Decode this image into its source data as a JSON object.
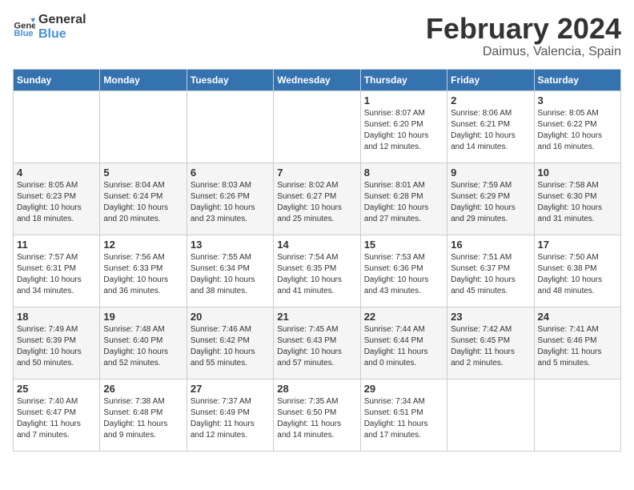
{
  "header": {
    "logo_line1": "General",
    "logo_line2": "Blue",
    "month": "February 2024",
    "location": "Daimus, Valencia, Spain"
  },
  "days_of_week": [
    "Sunday",
    "Monday",
    "Tuesday",
    "Wednesday",
    "Thursday",
    "Friday",
    "Saturday"
  ],
  "weeks": [
    [
      {
        "day": "",
        "info": ""
      },
      {
        "day": "",
        "info": ""
      },
      {
        "day": "",
        "info": ""
      },
      {
        "day": "",
        "info": ""
      },
      {
        "day": "1",
        "info": "Sunrise: 8:07 AM\nSunset: 6:20 PM\nDaylight: 10 hours\nand 12 minutes."
      },
      {
        "day": "2",
        "info": "Sunrise: 8:06 AM\nSunset: 6:21 PM\nDaylight: 10 hours\nand 14 minutes."
      },
      {
        "day": "3",
        "info": "Sunrise: 8:05 AM\nSunset: 6:22 PM\nDaylight: 10 hours\nand 16 minutes."
      }
    ],
    [
      {
        "day": "4",
        "info": "Sunrise: 8:05 AM\nSunset: 6:23 PM\nDaylight: 10 hours\nand 18 minutes."
      },
      {
        "day": "5",
        "info": "Sunrise: 8:04 AM\nSunset: 6:24 PM\nDaylight: 10 hours\nand 20 minutes."
      },
      {
        "day": "6",
        "info": "Sunrise: 8:03 AM\nSunset: 6:26 PM\nDaylight: 10 hours\nand 23 minutes."
      },
      {
        "day": "7",
        "info": "Sunrise: 8:02 AM\nSunset: 6:27 PM\nDaylight: 10 hours\nand 25 minutes."
      },
      {
        "day": "8",
        "info": "Sunrise: 8:01 AM\nSunset: 6:28 PM\nDaylight: 10 hours\nand 27 minutes."
      },
      {
        "day": "9",
        "info": "Sunrise: 7:59 AM\nSunset: 6:29 PM\nDaylight: 10 hours\nand 29 minutes."
      },
      {
        "day": "10",
        "info": "Sunrise: 7:58 AM\nSunset: 6:30 PM\nDaylight: 10 hours\nand 31 minutes."
      }
    ],
    [
      {
        "day": "11",
        "info": "Sunrise: 7:57 AM\nSunset: 6:31 PM\nDaylight: 10 hours\nand 34 minutes."
      },
      {
        "day": "12",
        "info": "Sunrise: 7:56 AM\nSunset: 6:33 PM\nDaylight: 10 hours\nand 36 minutes."
      },
      {
        "day": "13",
        "info": "Sunrise: 7:55 AM\nSunset: 6:34 PM\nDaylight: 10 hours\nand 38 minutes."
      },
      {
        "day": "14",
        "info": "Sunrise: 7:54 AM\nSunset: 6:35 PM\nDaylight: 10 hours\nand 41 minutes."
      },
      {
        "day": "15",
        "info": "Sunrise: 7:53 AM\nSunset: 6:36 PM\nDaylight: 10 hours\nand 43 minutes."
      },
      {
        "day": "16",
        "info": "Sunrise: 7:51 AM\nSunset: 6:37 PM\nDaylight: 10 hours\nand 45 minutes."
      },
      {
        "day": "17",
        "info": "Sunrise: 7:50 AM\nSunset: 6:38 PM\nDaylight: 10 hours\nand 48 minutes."
      }
    ],
    [
      {
        "day": "18",
        "info": "Sunrise: 7:49 AM\nSunset: 6:39 PM\nDaylight: 10 hours\nand 50 minutes."
      },
      {
        "day": "19",
        "info": "Sunrise: 7:48 AM\nSunset: 6:40 PM\nDaylight: 10 hours\nand 52 minutes."
      },
      {
        "day": "20",
        "info": "Sunrise: 7:46 AM\nSunset: 6:42 PM\nDaylight: 10 hours\nand 55 minutes."
      },
      {
        "day": "21",
        "info": "Sunrise: 7:45 AM\nSunset: 6:43 PM\nDaylight: 10 hours\nand 57 minutes."
      },
      {
        "day": "22",
        "info": "Sunrise: 7:44 AM\nSunset: 6:44 PM\nDaylight: 11 hours\nand 0 minutes."
      },
      {
        "day": "23",
        "info": "Sunrise: 7:42 AM\nSunset: 6:45 PM\nDaylight: 11 hours\nand 2 minutes."
      },
      {
        "day": "24",
        "info": "Sunrise: 7:41 AM\nSunset: 6:46 PM\nDaylight: 11 hours\nand 5 minutes."
      }
    ],
    [
      {
        "day": "25",
        "info": "Sunrise: 7:40 AM\nSunset: 6:47 PM\nDaylight: 11 hours\nand 7 minutes."
      },
      {
        "day": "26",
        "info": "Sunrise: 7:38 AM\nSunset: 6:48 PM\nDaylight: 11 hours\nand 9 minutes."
      },
      {
        "day": "27",
        "info": "Sunrise: 7:37 AM\nSunset: 6:49 PM\nDaylight: 11 hours\nand 12 minutes."
      },
      {
        "day": "28",
        "info": "Sunrise: 7:35 AM\nSunset: 6:50 PM\nDaylight: 11 hours\nand 14 minutes."
      },
      {
        "day": "29",
        "info": "Sunrise: 7:34 AM\nSunset: 6:51 PM\nDaylight: 11 hours\nand 17 minutes."
      },
      {
        "day": "",
        "info": ""
      },
      {
        "day": "",
        "info": ""
      }
    ]
  ]
}
